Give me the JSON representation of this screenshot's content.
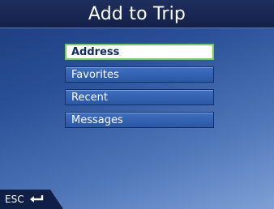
{
  "header": {
    "title": "Add to Trip"
  },
  "menu": {
    "items": [
      {
        "label": "Address",
        "selected": true
      },
      {
        "label": "Favorites",
        "selected": false
      },
      {
        "label": "Recent",
        "selected": false
      },
      {
        "label": "Messages",
        "selected": false
      }
    ]
  },
  "footer": {
    "esc_label": "ESC",
    "esc_icon": "return-arrow-icon"
  },
  "colors": {
    "title_bar": "#132149",
    "button": "#2b57a3",
    "selected_border": "#6fcf52",
    "background_accent": "#7fa0d6"
  }
}
